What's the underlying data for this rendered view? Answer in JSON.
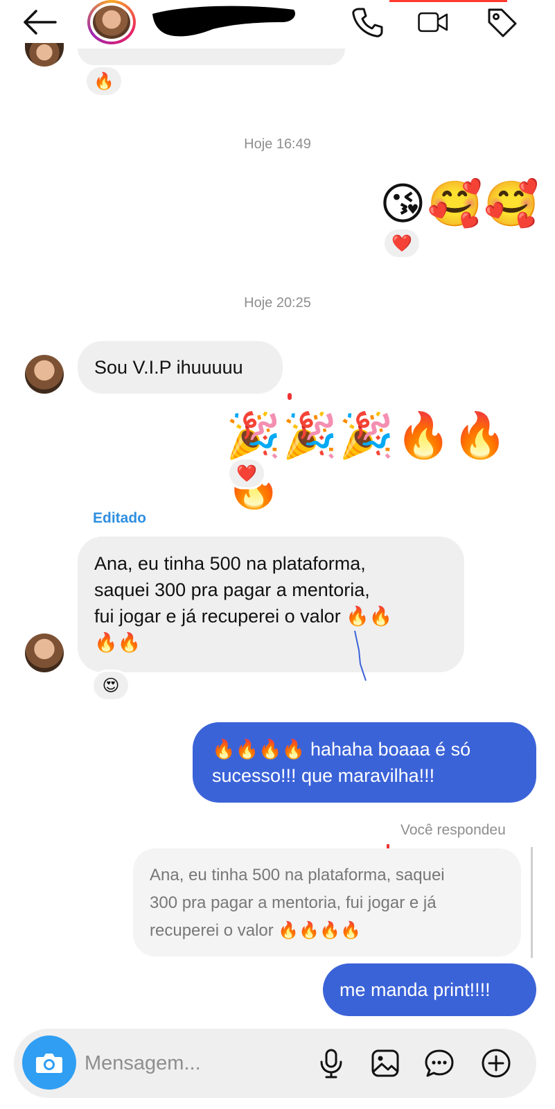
{
  "header": {
    "back_icon": "arrow-left-icon",
    "contact_name": "",
    "icons": [
      "phone-icon",
      "video-camera-icon",
      "tag-icon"
    ]
  },
  "thread": {
    "top_reaction": "🔥",
    "timestamp_1": "Hoje 16:49",
    "out_emojis_1": "😘🥰🥰",
    "out_emojis_1_reaction": "❤️",
    "timestamp_2": "Hoje 20:25",
    "in_msg_1": "Sou V.I.P ihuuuuu",
    "out_emojis_2": "🎉🎉🎉🔥🔥🔥",
    "out_emojis_2_reaction": "❤️",
    "edited_label": "Editado",
    "in_msg_2_line1": "Ana, eu tinha 500 na plataforma,",
    "in_msg_2_line2": "saquei 300 pra pagar a mentoria,",
    "in_msg_2_line3": "fui jogar e já recuperei o valor 🔥🔥",
    "in_msg_2_line4": "🔥🔥",
    "in_msg_2_reaction": "😍",
    "out_msg_1_line1": "🔥🔥🔥🔥 hahaha boaaa é só",
    "out_msg_1_line2": "sucesso!!! que maravilha!!!",
    "replied_label": "Você respondeu",
    "quoted_line1": "Ana, eu tinha 500 na plataforma, saquei",
    "quoted_line2": "300 pra pagar a mentoria, fui jogar e já",
    "quoted_line3": "recuperei o valor 🔥🔥🔥🔥",
    "out_msg_2": "me manda print!!!!"
  },
  "composer": {
    "placeholder": "Mensagem...",
    "icons": [
      "camera-icon",
      "microphone-icon",
      "gallery-icon",
      "sticker-chat-icon",
      "plus-circle-icon"
    ]
  },
  "colors": {
    "outgoing_bubble": "#3b63d8",
    "incoming_bubble": "#efefef",
    "edited_label": "#2f8fe0",
    "camera_button": "#2f9ef3",
    "timestamp": "#8e8e8e"
  }
}
